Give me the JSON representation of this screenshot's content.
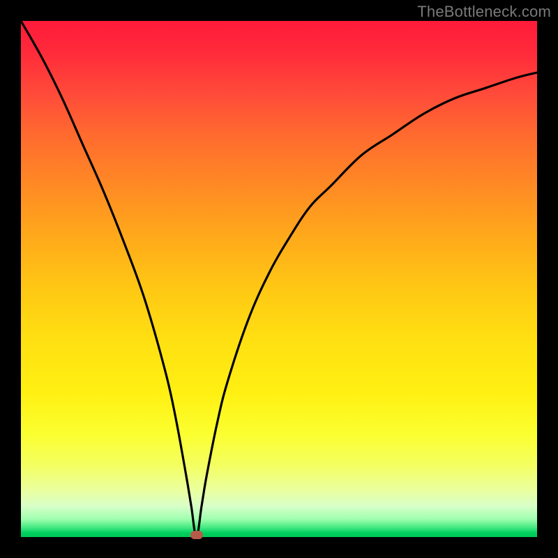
{
  "attribution": "TheBottleneck.com",
  "colors": {
    "frame": "#000000",
    "curve": "#000000",
    "marker": "#b65a4a"
  },
  "chart_data": {
    "type": "line",
    "title": "",
    "xlabel": "",
    "ylabel": "",
    "xlim": [
      0,
      100
    ],
    "ylim": [
      0,
      100
    ],
    "grid": false,
    "legend": false,
    "gradient_meaning": "high (red) to low (green) bottleneck",
    "minimum_x": 34,
    "marker": {
      "x": 34,
      "y": 0
    },
    "series": [
      {
        "name": "bottleneck-curve",
        "x": [
          0,
          4,
          8,
          12,
          16,
          20,
          24,
          28,
          30,
          32,
          33,
          34,
          35,
          36,
          38,
          40,
          44,
          48,
          52,
          56,
          60,
          66,
          72,
          78,
          84,
          90,
          96,
          100
        ],
        "values": [
          100,
          93,
          85,
          76,
          67,
          57,
          46,
          32,
          23,
          12,
          6,
          0,
          6,
          12,
          22,
          30,
          42,
          51,
          58,
          64,
          68,
          74,
          78,
          82,
          85,
          87,
          89,
          90
        ]
      }
    ]
  }
}
